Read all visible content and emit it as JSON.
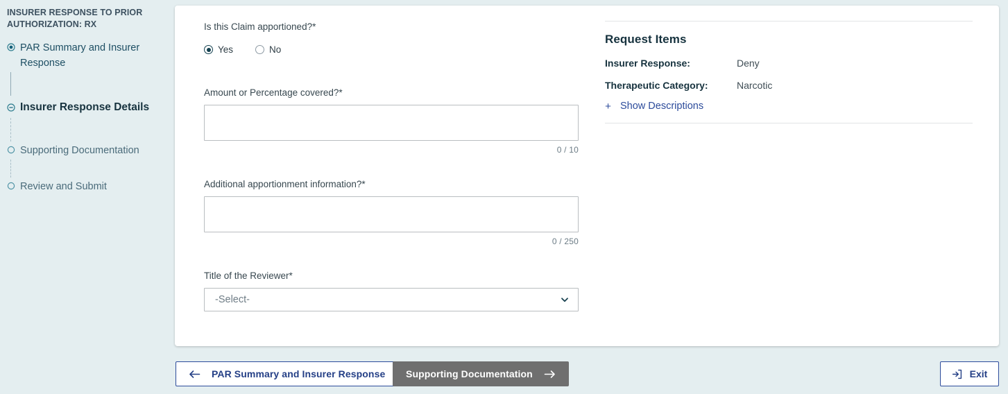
{
  "sidebar": {
    "title": "INSURER RESPONSE TO PRIOR AUTHORIZATION: RX",
    "steps": [
      {
        "label": "PAR Summary and Insurer Response",
        "state": "done",
        "icon": "radio-filled-icon"
      },
      {
        "label": "Insurer Response Details",
        "state": "active",
        "icon": "circle-minus-icon"
      },
      {
        "label": "Supporting Documentation",
        "state": "todo",
        "icon": "circle-empty-icon"
      },
      {
        "label": "Review and Submit",
        "state": "todo",
        "icon": "circle-empty-icon"
      }
    ]
  },
  "form": {
    "apportioned": {
      "label": "Is this Claim apportioned?*",
      "options": [
        {
          "label": "Yes",
          "selected": true
        },
        {
          "label": "No",
          "selected": false
        }
      ]
    },
    "amount": {
      "label": "Amount or Percentage covered?*",
      "value": "",
      "placeholder": "",
      "counter": "0 / 10"
    },
    "additional": {
      "label": "Additional apportionment information?*",
      "value": "",
      "placeholder": "",
      "counter": "0 / 250"
    },
    "reviewer_title": {
      "label": "Title of the Reviewer*",
      "selected": "-Select-",
      "options": [
        "-Select-"
      ]
    }
  },
  "request_items": {
    "title": "Request Items",
    "rows": [
      {
        "key": "Insurer Response:",
        "value": "Deny"
      },
      {
        "key": "Therapeutic Category:",
        "value": "Narcotic"
      }
    ],
    "show_descriptions": {
      "label": "Show Descriptions",
      "icon": "plus-icon"
    }
  },
  "footer": {
    "back": {
      "label": "PAR Summary and Insurer Response",
      "icon": "arrow-left-icon"
    },
    "next": {
      "label": "Supporting Documentation",
      "icon": "arrow-right-icon"
    },
    "exit": {
      "label": "Exit",
      "icon": "sign-out-icon"
    }
  },
  "colors": {
    "page_background": "#e4eef0",
    "card_background": "#ffffff",
    "link_blue": "#2c4b9b",
    "primary_dark": "#13404f",
    "next_button_gray": "#6f6f6f"
  }
}
